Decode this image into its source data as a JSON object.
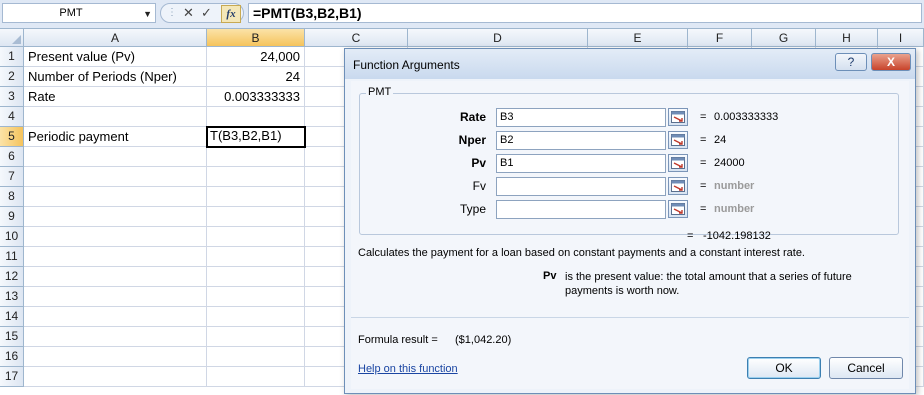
{
  "formula_bar": {
    "name_box": "PMT",
    "formula": "=PMT(B3,B2,B1)",
    "fx_label": "fx"
  },
  "columns": [
    "A",
    "B",
    "C",
    "D",
    "E",
    "F",
    "G",
    "H",
    "I"
  ],
  "rows": [
    "1",
    "2",
    "3",
    "4",
    "5",
    "6",
    "7",
    "8",
    "9",
    "10",
    "11",
    "12",
    "13",
    "14",
    "15",
    "16",
    "17"
  ],
  "cells": {
    "A1": "Present value (Pv)",
    "B1": "24,000",
    "A2": "Number of Periods (Nper)",
    "B2": "24",
    "A3": "Rate",
    "B3": "0.003333333",
    "A5": "Periodic payment",
    "B5": "T(B3,B2,B1)"
  },
  "dialog": {
    "title": "Function Arguments",
    "help_button": "?",
    "close_button": "X",
    "function_name": "PMT",
    "args": [
      {
        "label": "Rate",
        "input": "B3",
        "value": "0.003333333",
        "required": true
      },
      {
        "label": "Nper",
        "input": "B2",
        "value": "24",
        "required": true
      },
      {
        "label": "Pv",
        "input": "B1",
        "value": "24000",
        "required": true
      },
      {
        "label": "Fv",
        "input": "",
        "value": "number",
        "required": false
      },
      {
        "label": "Type",
        "input": "",
        "value": "number",
        "required": false
      }
    ],
    "equals": "=",
    "result_preview": "-1042.198132",
    "description": "Calculates the payment for a loan based on constant payments and a constant interest rate.",
    "arg_help_name": "Pv",
    "arg_help_text": "is the present value: the total amount that a series of future payments is worth now.",
    "formula_result_label": "Formula result =",
    "formula_result_value": "($1,042.20)",
    "help_link": "Help on this function",
    "ok_label": "OK",
    "cancel_label": "Cancel"
  }
}
